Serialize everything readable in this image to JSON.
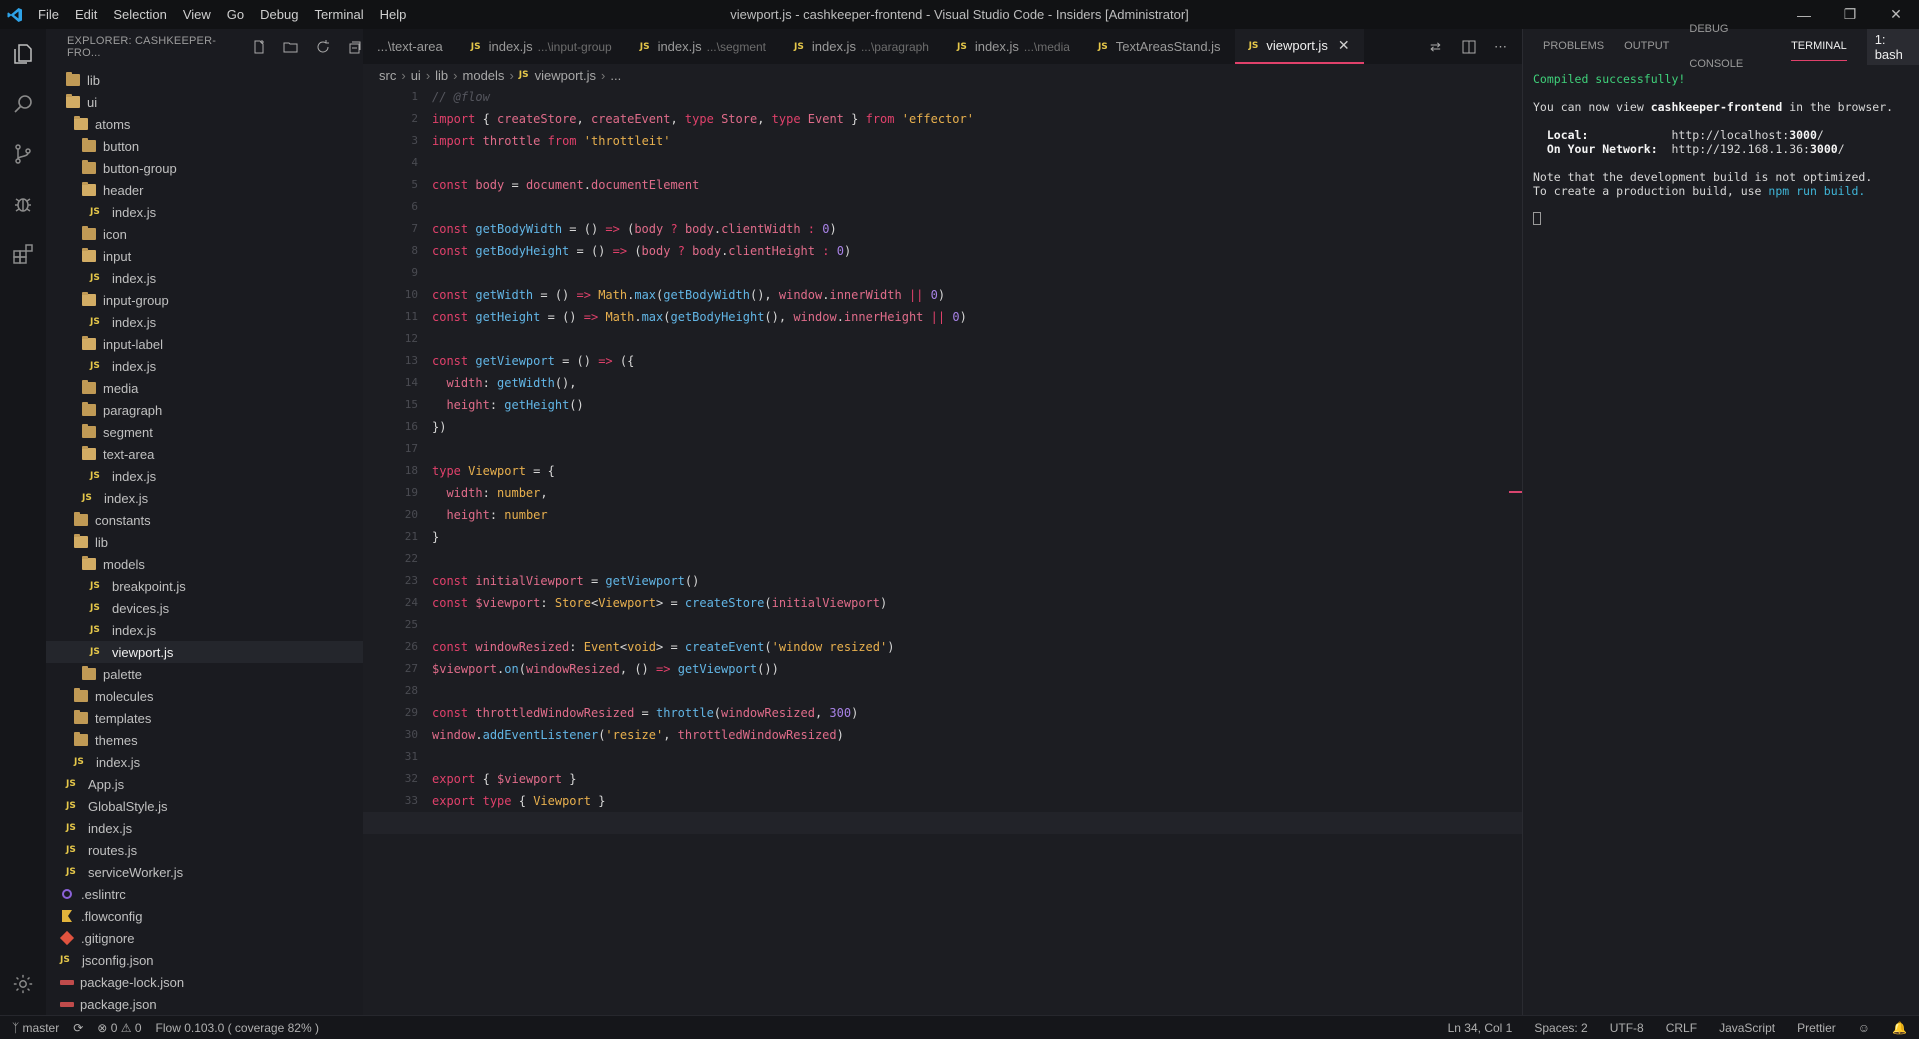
{
  "titlebar": {
    "menu": [
      "File",
      "Edit",
      "Selection",
      "View",
      "Go",
      "Debug",
      "Terminal",
      "Help"
    ],
    "title": "viewport.js - cashkeeper-frontend - Visual Studio Code - Insiders [Administrator]"
  },
  "sidebar": {
    "header": "EXPLORER: CASHKEEPER-FRO...",
    "items": [
      {
        "label": "lib",
        "type": "folder"
      },
      {
        "label": "ui",
        "type": "folder-open"
      },
      {
        "label": "atoms",
        "type": "folder-open"
      },
      {
        "label": "button",
        "type": "folder"
      },
      {
        "label": "button-group",
        "type": "folder"
      },
      {
        "label": "header",
        "type": "folder-open"
      },
      {
        "label": "index.js",
        "type": "js"
      },
      {
        "label": "icon",
        "type": "folder"
      },
      {
        "label": "input",
        "type": "folder-open"
      },
      {
        "label": "index.js",
        "type": "js"
      },
      {
        "label": "input-group",
        "type": "folder-open"
      },
      {
        "label": "index.js",
        "type": "js"
      },
      {
        "label": "input-label",
        "type": "folder-open"
      },
      {
        "label": "index.js",
        "type": "js"
      },
      {
        "label": "media",
        "type": "folder"
      },
      {
        "label": "paragraph",
        "type": "folder"
      },
      {
        "label": "segment",
        "type": "folder"
      },
      {
        "label": "text-area",
        "type": "folder-open"
      },
      {
        "label": "index.js",
        "type": "js"
      },
      {
        "label": "index.js",
        "type": "js"
      },
      {
        "label": "constants",
        "type": "folder"
      },
      {
        "label": "lib",
        "type": "folder-open"
      },
      {
        "label": "models",
        "type": "folder-open"
      },
      {
        "label": "breakpoint.js",
        "type": "js"
      },
      {
        "label": "devices.js",
        "type": "js"
      },
      {
        "label": "index.js",
        "type": "js"
      },
      {
        "label": "viewport.js",
        "type": "js"
      },
      {
        "label": "palette",
        "type": "folder"
      },
      {
        "label": "molecules",
        "type": "folder"
      },
      {
        "label": "templates",
        "type": "folder"
      },
      {
        "label": "themes",
        "type": "folder"
      },
      {
        "label": "index.js",
        "type": "js"
      },
      {
        "label": "App.js",
        "type": "js"
      },
      {
        "label": "GlobalStyle.js",
        "type": "js"
      },
      {
        "label": "index.js",
        "type": "js"
      },
      {
        "label": "routes.js",
        "type": "js"
      },
      {
        "label": "serviceWorker.js",
        "type": "js"
      },
      {
        "label": ".eslintrc",
        "type": "eslint"
      },
      {
        "label": ".flowconfig",
        "type": "flow"
      },
      {
        "label": ".gitignore",
        "type": "git"
      },
      {
        "label": "jsconfig.json",
        "type": "js"
      },
      {
        "label": "package-lock.json",
        "type": "json"
      },
      {
        "label": "package.json",
        "type": "json"
      }
    ]
  },
  "tabs": [
    {
      "label": "...\\text-area",
      "desc": ""
    },
    {
      "label": "index.js",
      "desc": "...\\input-group"
    },
    {
      "label": "index.js",
      "desc": "...\\segment"
    },
    {
      "label": "index.js",
      "desc": "...\\paragraph"
    },
    {
      "label": "index.js",
      "desc": "...\\media"
    },
    {
      "label": "TextAreasStand.js",
      "desc": ""
    },
    {
      "label": "viewport.js",
      "desc": "",
      "active": true
    }
  ],
  "breadcrumb": [
    "src",
    "ui",
    "lib",
    "models",
    "viewport.js",
    "..."
  ],
  "editor": {
    "current_line": 34
  },
  "panel": {
    "tabs": [
      "PROBLEMS",
      "OUTPUT",
      "DEBUG CONSOLE",
      "TERMINAL"
    ],
    "shell": "1: bash",
    "compiled": "Compiled successfully!",
    "view_pre": "You can now view ",
    "project": "cashkeeper-frontend",
    "view_post": " in the browser.",
    "local_label": "Local:",
    "local_url_pre": "http://localhost:",
    "local_port": "3000",
    "local_url_post": "/",
    "net_label": "On Your Network:",
    "net_url_pre": "http://192.168.1.36:",
    "net_port": "3000",
    "net_url_post": "/",
    "note1": "Note that the development build is not optimized.",
    "note2_pre": "To create a production build, use ",
    "note2_cmd": "npm run build",
    "note2_post": "."
  },
  "statusbar": {
    "branch": "master",
    "errors": "0",
    "warnings": "0",
    "flow": "Flow 0.103.0 ( coverage 82% )",
    "position": "Ln 34, Col 1",
    "spaces": "Spaces: 2",
    "encoding": "UTF-8",
    "eol": "CRLF",
    "language": "JavaScript",
    "formatter": "Prettier"
  }
}
